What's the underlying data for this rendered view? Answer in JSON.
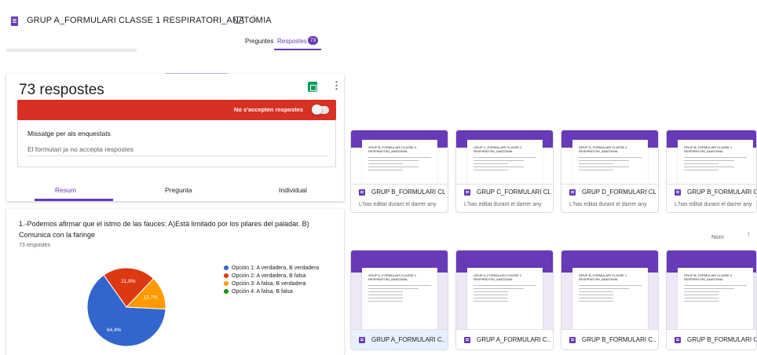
{
  "header": {
    "title": "GRUP A_FORMULARI CLASSE 1 RESPIRATORI_ANATOMIA",
    "tabs": [
      {
        "label": "Preguntes"
      },
      {
        "label": "Respostes"
      }
    ],
    "badge": "73"
  },
  "responses": {
    "count_title": "73 respostes",
    "banner_text": "No s'accepten respostes",
    "message_label": "Missatge per als enquestats",
    "message_value": "El formulari ja no accepta respostes",
    "tabs": [
      {
        "label": "Resum"
      },
      {
        "label": "Pregunta"
      },
      {
        "label": "Individual"
      }
    ]
  },
  "question": {
    "text": "1.-Podemos afirmar que el istmo de las fauces: A)Está limitado por los pilares del paladar. B) Comunica con la faringe",
    "count": "73 respostes"
  },
  "chart_data": {
    "type": "pie",
    "categories": [
      "Opción 1: A verdadera, B verdadera",
      "Opción 2: A verdadera, B falsa",
      "Opción 3: A falsa, B verdadera",
      "Opción 4: A falsa, B falsa"
    ],
    "values": [
      64.4,
      21.9,
      13.7,
      0
    ],
    "labels": [
      "64,4%",
      "21,9%",
      "13,7%",
      ""
    ],
    "colors": [
      "#3366cc",
      "#dc3912",
      "#ff9900",
      "#109618"
    ],
    "legend_position": "right"
  },
  "forms": {
    "top": [
      {
        "doc_title": "GRUP B_FORMULARI CLASSE 3 RESPIRATORI_ANATOMIA",
        "name": "GRUP B_FORMULARI CL...",
        "subtitle": "L'has editat durant el darrer any"
      },
      {
        "doc_title": "GRUP C_FORMULARI CLASSE 2 RESPIRATORI_ANATOMIA",
        "name": "GRUP C_FORMULARI CL...",
        "subtitle": "L'has editat durant el darrer any"
      },
      {
        "doc_title": "GRUP D_FORMULARI CLASSE 2 RESPIRATORI_ANATOMIA",
        "name": "GRUP D_FORMULARI CL...",
        "subtitle": "L'has editat durant el darrer any"
      },
      {
        "doc_title": "GRUP B_FORMULARI CLASSE 1 RESPIRATORI_ANATOMIA",
        "name": "GRUP B_FORMULARI CL...",
        "subtitle": "L'has editat durant el darrer any"
      }
    ],
    "bottom": [
      {
        "doc_title": "GRUP A_FORMULARI CLASSE 1 RESPIRATORI_ANATOMIA",
        "name": "GRUP A_FORMULARI C..."
      },
      {
        "doc_title": "GRUP A_FORMULARI CLASSE 2 RESPIRATORI_ANATOMIA",
        "name": "GRUP A_FORMULARI C..."
      },
      {
        "doc_title": "GRUP B_FORMULARI CLASSE 1 RESPIRATORI_ANATOMIA",
        "name": "GRUP B_FORMULARI C..."
      },
      {
        "doc_title": "GRUP B_FORMULARI CLASSE 2 RESPIRATORI_ANATOMIA",
        "name": "GRUP B_FORMULARI C..."
      }
    ]
  },
  "sort": {
    "label": "Nom",
    "arrow": "↑"
  },
  "icons": {
    "form": "form-icon",
    "folder": "folder-icon",
    "star": "star-icon",
    "sheets": "sheets-icon",
    "more": "more-vert-icon",
    "sort": "arrow-up-icon"
  }
}
